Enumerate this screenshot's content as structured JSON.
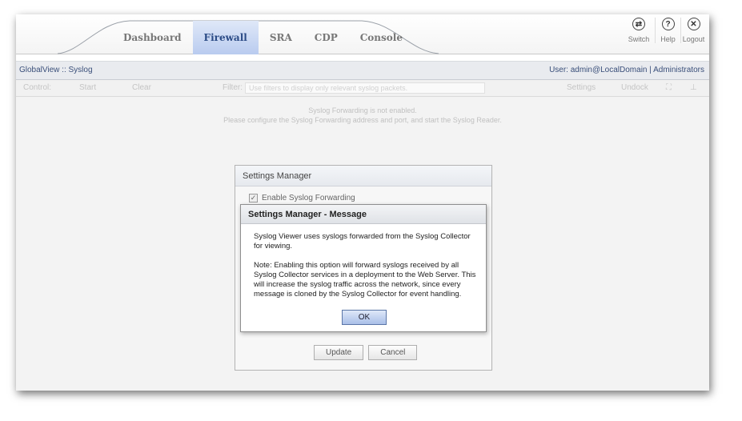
{
  "header": {
    "tabs": [
      {
        "label": "Dashboard",
        "active": false
      },
      {
        "label": "Firewall",
        "active": true
      },
      {
        "label": "SRA",
        "active": false
      },
      {
        "label": "CDP",
        "active": false
      },
      {
        "label": "Console",
        "active": false
      }
    ],
    "actions": [
      {
        "label": "Switch",
        "icon": "switch-icon",
        "glyph": "⇄"
      },
      {
        "label": "Help",
        "icon": "help-icon",
        "glyph": "?"
      },
      {
        "label": "Logout",
        "icon": "logout-icon",
        "glyph": "✕"
      }
    ]
  },
  "breadcrumb": "GlobalView :: Syslog",
  "user_info": "User: admin@LocalDomain | Administrators",
  "toolbar": {
    "control": "Control:",
    "start": "Start",
    "clear": "Clear",
    "filter_label": "Filter:",
    "filter_placeholder": "Use filters to display only relevant syslog packets.",
    "settings": "Settings",
    "undock": "Undock"
  },
  "notice": {
    "line1": "Syslog Forwarding is not enabled.",
    "line2": "Please configure the Syslog Forwarding address and port, and start the Syslog Reader."
  },
  "settings_manager": {
    "title": "Settings Manager",
    "enable_label": "Enable Syslog Forwarding",
    "update": "Update",
    "cancel": "Cancel"
  },
  "message_dialog": {
    "title": "Settings Manager - Message",
    "para1": "Syslog Viewer uses syslogs forwarded from the Syslog Collector for viewing.",
    "para2": "Note: Enabling this option will forward syslogs received by all Syslog Collector services in a deployment to the Web Server. This will increase the syslog traffic across the network, since every message is cloned by the Syslog Collector for event handling.",
    "ok": "OK"
  }
}
